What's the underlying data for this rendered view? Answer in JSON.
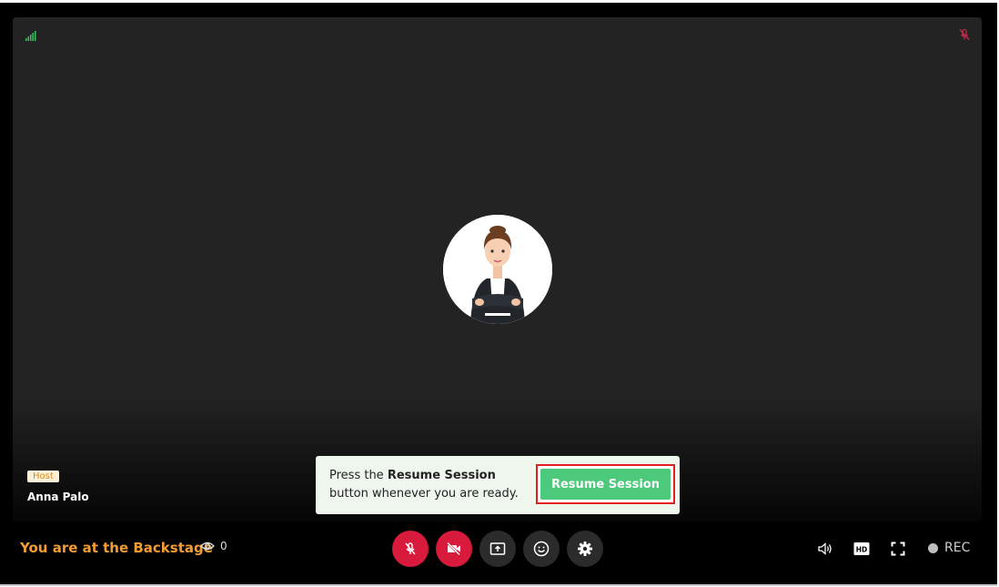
{
  "stage": {
    "host_badge": "Host",
    "host_name": "Anna Palo"
  },
  "notice": {
    "text_prefix": "Press the ",
    "text_bold": "Resume Session",
    "text_suffix": " button whenever you are ready.",
    "button_label": "Resume Session"
  },
  "bottom_bar": {
    "backstage_label": "You are at the Backstage",
    "viewer_count": "0",
    "rec_label": "REC"
  },
  "colors": {
    "accent_orange": "#f39c34",
    "button_red": "#d81b3c",
    "resume_green": "#4cc97a",
    "signal_green": "#3fbf6a"
  },
  "icons": {
    "signal": "signal-icon",
    "mic_off_top": "mic-off-icon",
    "mic_off": "mic-off-icon",
    "video_off": "video-off-icon",
    "screen_share": "screen-share-icon",
    "emoji": "emoji-icon",
    "settings": "gear-icon",
    "volume": "volume-icon",
    "hd": "hd-icon",
    "fullscreen": "fullscreen-icon",
    "viewers": "eye-icon"
  }
}
